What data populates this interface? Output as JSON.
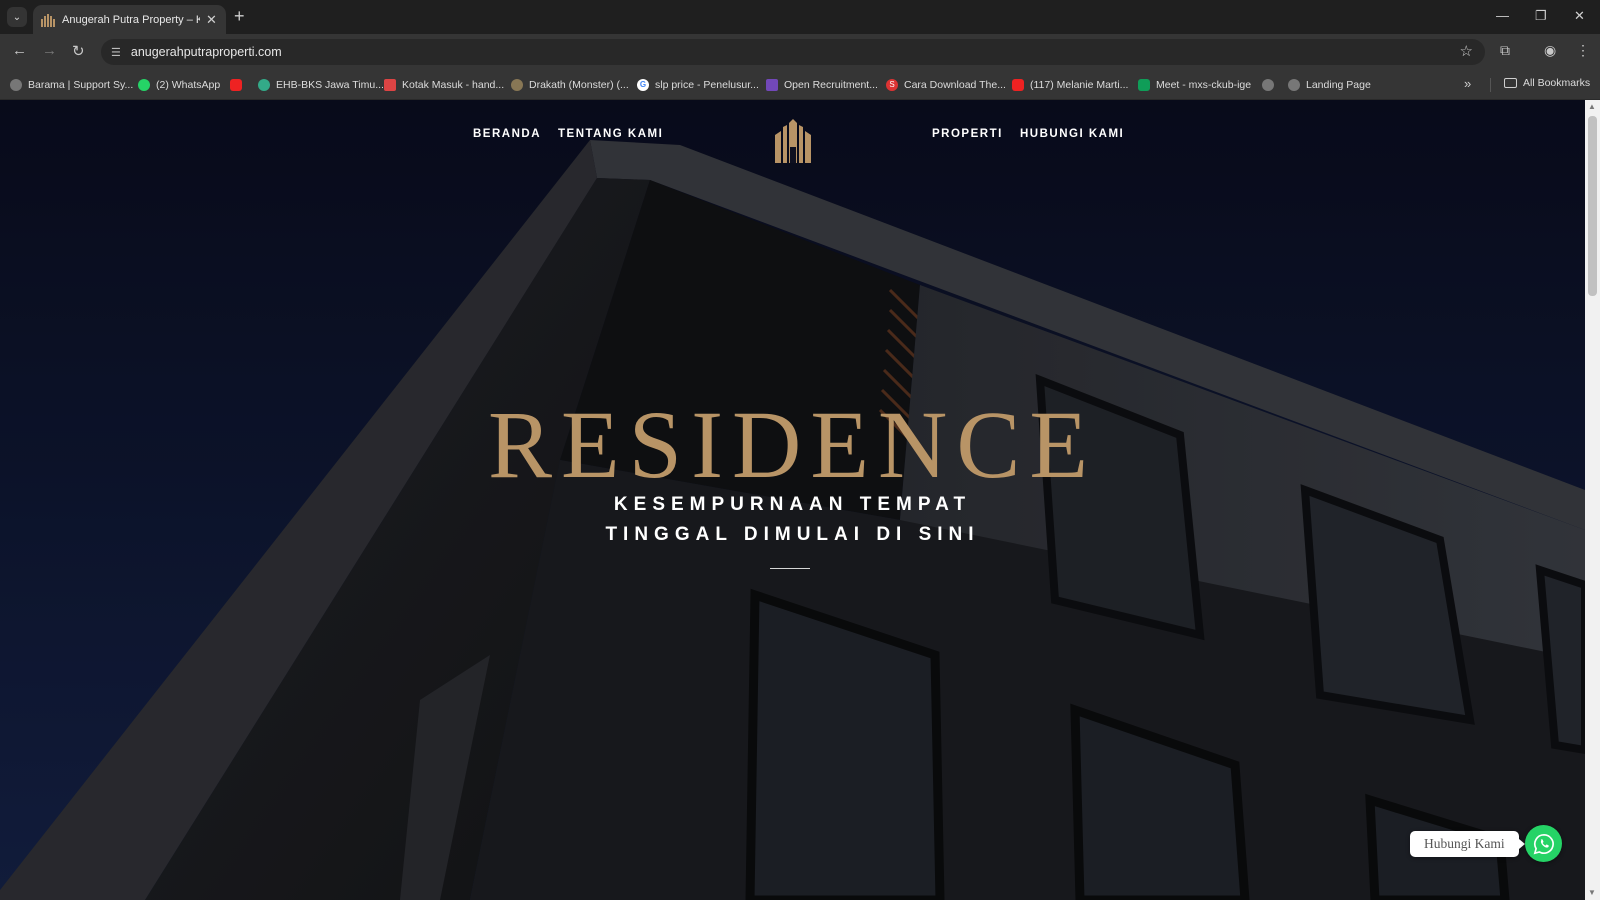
{
  "browser": {
    "tab_title": "Anugerah Putra Property – Kesempurnaan Tempat Tinggal Dimulai Di Sini",
    "url": "anugerahputraproperti.com",
    "bookmarks": [
      {
        "label": "Barama | Support Sy...",
        "icon": "globe-icon"
      },
      {
        "label": "(2) WhatsApp",
        "icon": "whatsapp-icon"
      },
      {
        "label": "",
        "icon": "youtube-icon"
      },
      {
        "label": "EHB-BKS Jawa Timu...",
        "icon": "site-icon"
      },
      {
        "label": "Kotak Masuk - hand...",
        "icon": "gmail-icon"
      },
      {
        "label": "Drakath (Monster) (...",
        "icon": "game-icon"
      },
      {
        "label": "slp price - Penelusur...",
        "icon": "google-icon"
      },
      {
        "label": "Open Recruitment...",
        "icon": "forms-icon"
      },
      {
        "label": "Cara Download The...",
        "icon": "s-icon"
      },
      {
        "label": "(117) Melanie Marti...",
        "icon": "youtube-icon"
      },
      {
        "label": "Meet - mxs-ckub-ige",
        "icon": "meet-icon"
      },
      {
        "label": "",
        "icon": "globe-icon"
      },
      {
        "label": "Landing Page",
        "icon": "globe-icon"
      }
    ],
    "all_bookmarks": "All Bookmarks"
  },
  "site": {
    "nav_left": [
      "BERANDA",
      "TENTANG KAMI"
    ],
    "nav_right": [
      "PROPERTI",
      "HUBUNGI KAMI"
    ],
    "logo": "building-logo-icon",
    "headline": "RESIDENCE",
    "subline_1": "KESEMPURNAAN TEMPAT",
    "subline_2": "TINGGAL DIMULAI DI SINI",
    "whatsapp_label": "Hubungi Kami"
  },
  "colors": {
    "accent_gold": "#b89466",
    "whatsapp_green": "#25d366"
  }
}
